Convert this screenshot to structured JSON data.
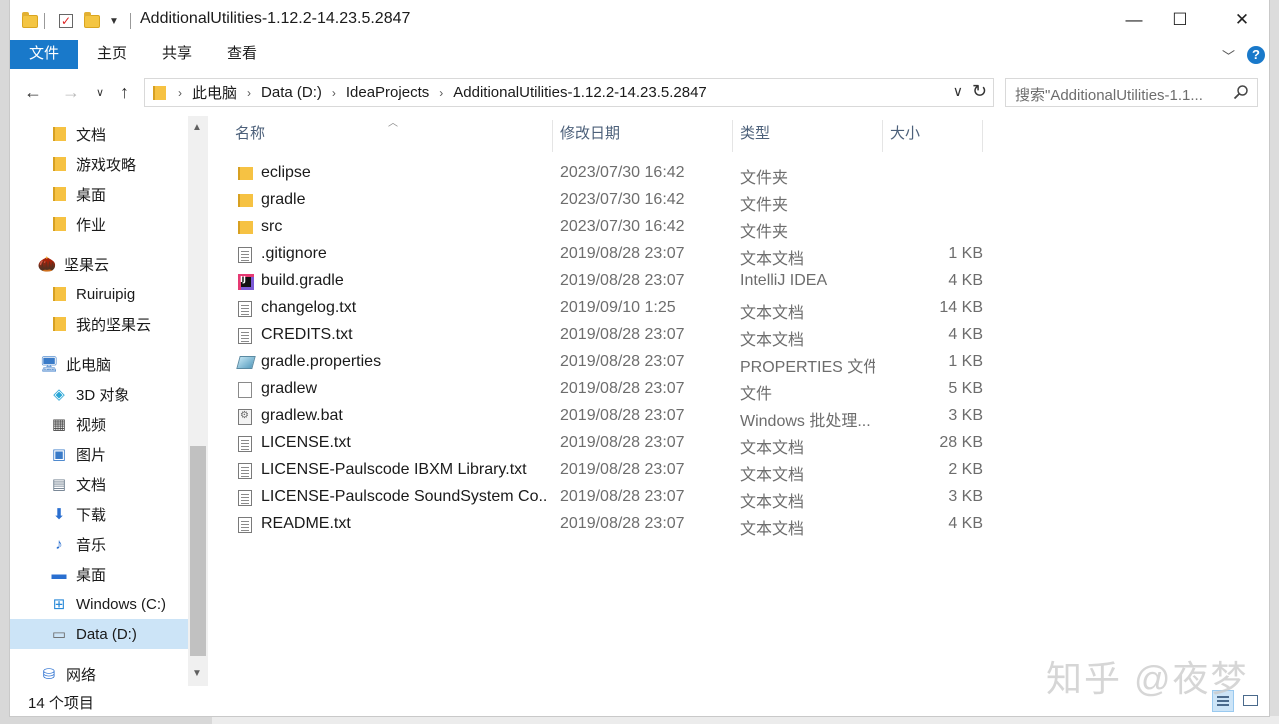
{
  "window": {
    "title": "AdditionalUtilities-1.12.2-14.23.5.2847",
    "minimize": "—",
    "maximize": "☐",
    "close": "✕"
  },
  "ribbon": {
    "tabs": [
      "文件",
      "主页",
      "共享",
      "查看"
    ],
    "help": "?"
  },
  "nav": {
    "breadcrumbs": [
      "此电脑",
      "Data (D:)",
      "IdeaProjects",
      "AdditionalUtilities-1.12.2-14.23.5.2847"
    ],
    "search_placeholder": "搜索\"AdditionalUtilities-1.1..."
  },
  "sidebar": {
    "items": [
      {
        "label": "文档",
        "icon": "folder-icon"
      },
      {
        "label": "游戏攻略",
        "icon": "folder-icon"
      },
      {
        "label": "桌面",
        "icon": "folder-icon"
      },
      {
        "label": "作业",
        "icon": "folder-icon"
      },
      {
        "label": "坚果云",
        "icon": "nutstore-icon"
      },
      {
        "label": "Ruiruipig",
        "icon": "folder-icon"
      },
      {
        "label": "我的坚果云",
        "icon": "folder-icon"
      },
      {
        "label": "此电脑",
        "icon": "computer-icon"
      },
      {
        "label": "3D 对象",
        "icon": "3d-objects-icon"
      },
      {
        "label": "视频",
        "icon": "video-icon"
      },
      {
        "label": "图片",
        "icon": "pictures-icon"
      },
      {
        "label": "文档",
        "icon": "documents-icon"
      },
      {
        "label": "下载",
        "icon": "download-icon"
      },
      {
        "label": "音乐",
        "icon": "music-icon"
      },
      {
        "label": "桌面",
        "icon": "desktop-icon"
      },
      {
        "label": "Windows (C:)",
        "icon": "windows-drive-icon"
      },
      {
        "label": "Data (D:)",
        "icon": "drive-icon",
        "selected": true
      },
      {
        "label": "网络",
        "icon": "network-icon"
      }
    ]
  },
  "columns": {
    "name": "名称",
    "date": "修改日期",
    "type": "类型",
    "size": "大小"
  },
  "files": [
    {
      "name": "eclipse",
      "date": "2023/07/30 16:42",
      "type": "文件夹",
      "size": "",
      "icon": "folder"
    },
    {
      "name": "gradle",
      "date": "2023/07/30 16:42",
      "type": "文件夹",
      "size": "",
      "icon": "folder"
    },
    {
      "name": "src",
      "date": "2023/07/30 16:42",
      "type": "文件夹",
      "size": "",
      "icon": "folder"
    },
    {
      "name": ".gitignore",
      "date": "2019/08/28 23:07",
      "type": "文本文档",
      "size": "1 KB",
      "icon": "doc"
    },
    {
      "name": "build.gradle",
      "date": "2019/08/28 23:07",
      "type": "IntelliJ IDEA",
      "size": "4 KB",
      "icon": "idea"
    },
    {
      "name": "changelog.txt",
      "date": "2019/09/10 1:25",
      "type": "文本文档",
      "size": "14 KB",
      "icon": "doc"
    },
    {
      "name": "CREDITS.txt",
      "date": "2019/08/28 23:07",
      "type": "文本文档",
      "size": "4 KB",
      "icon": "doc"
    },
    {
      "name": "gradle.properties",
      "date": "2019/08/28 23:07",
      "type": "PROPERTIES 文件",
      "size": "1 KB",
      "icon": "props"
    },
    {
      "name": "gradlew",
      "date": "2019/08/28 23:07",
      "type": "文件",
      "size": "5 KB",
      "icon": "blank"
    },
    {
      "name": "gradlew.bat",
      "date": "2019/08/28 23:07",
      "type": "Windows 批处理...",
      "size": "3 KB",
      "icon": "bat"
    },
    {
      "name": "LICENSE.txt",
      "date": "2019/08/28 23:07",
      "type": "文本文档",
      "size": "28 KB",
      "icon": "doc"
    },
    {
      "name": "LICENSE-Paulscode IBXM Library.txt",
      "date": "2019/08/28 23:07",
      "type": "文本文档",
      "size": "2 KB",
      "icon": "doc"
    },
    {
      "name": "LICENSE-Paulscode SoundSystem Co...",
      "date": "2019/08/28 23:07",
      "type": "文本文档",
      "size": "3 KB",
      "icon": "doc"
    },
    {
      "name": "README.txt",
      "date": "2019/08/28 23:07",
      "type": "文本文档",
      "size": "4 KB",
      "icon": "doc"
    }
  ],
  "status": {
    "item_count": "14 个项目"
  },
  "watermark": "知乎 @夜梦",
  "colors": {
    "accent": "#1979ca",
    "selection": "#cce4f7",
    "header_text": "#4c607a"
  }
}
